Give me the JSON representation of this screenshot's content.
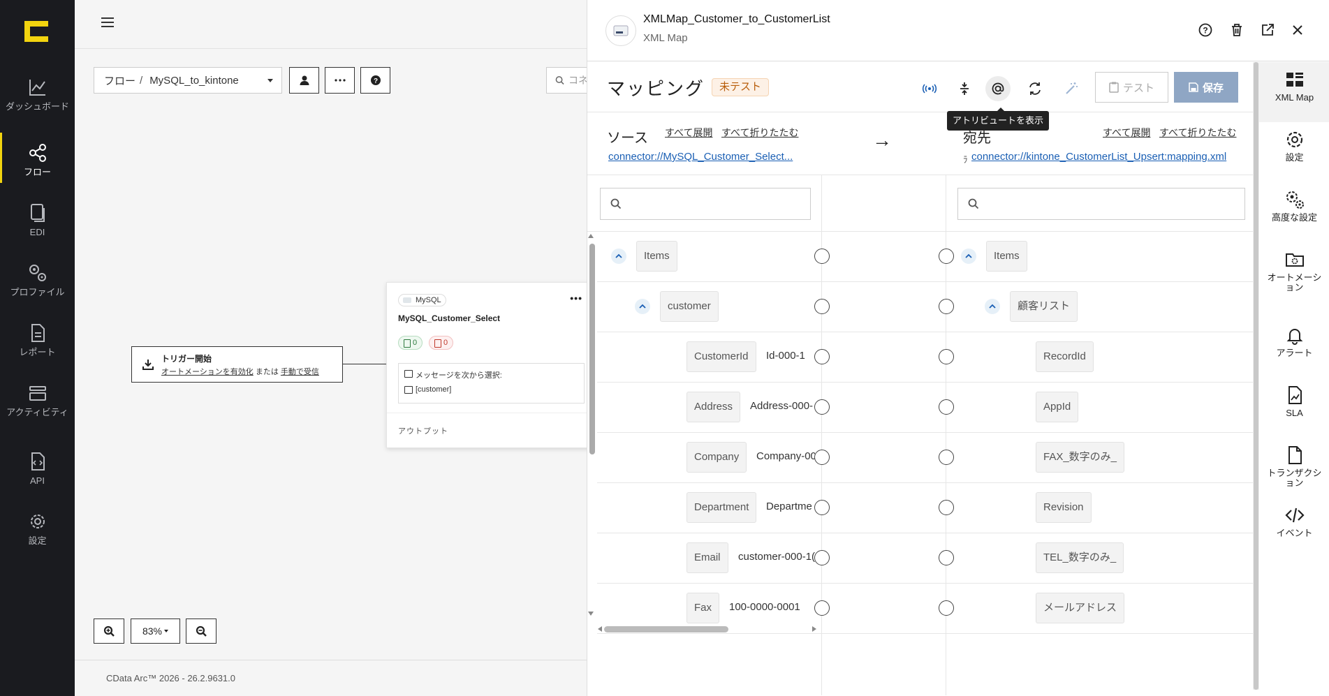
{
  "sidebar": {
    "items": [
      {
        "label": "ダッシュボード",
        "icon": "chart-line-icon"
      },
      {
        "label": "フロー",
        "icon": "flow-icon",
        "active": true
      },
      {
        "label": "EDI",
        "icon": "documents-icon"
      },
      {
        "label": "プロファイル",
        "icon": "gears-icon"
      },
      {
        "label": "レポート",
        "icon": "report-icon"
      },
      {
        "label": "アクティビティ",
        "icon": "activity-icon"
      },
      {
        "label": "API",
        "icon": "api-icon"
      },
      {
        "label": "設定",
        "icon": "gear-icon"
      }
    ]
  },
  "canvas": {
    "breadcrumb_prefix": "フロー",
    "breadcrumb_sep": "/",
    "flow_name": "MySQL_to_kintone",
    "search_placeholder": "コネ",
    "trigger": {
      "title": "トリガー開始",
      "link1": "オートメーションを有効化",
      "or_text": "または",
      "link2": "手動で受信"
    },
    "node": {
      "tag": "MySQL",
      "name": "MySQL_Customer_Select",
      "ok_count": "0",
      "err_count": "0",
      "msg_label": "メッセージを次から選択:",
      "msg_value": "[customer]",
      "output_label": "アウトプット"
    },
    "zoom_level": "83%",
    "footer": "CData Arc™ 2026 - 26.2.9631.0"
  },
  "panel": {
    "title": "XMLMap_Customer_to_CustomerList",
    "subtitle": "XML Map",
    "mapping_title": "マッピング",
    "status_badge": "未テスト",
    "tooltip": "アトリビュートを表示",
    "test_label": "テスト",
    "save_label": "保存",
    "source": {
      "label": "ソース",
      "expand_all": "すべて展開",
      "collapse_all": "すべて折りたたむ",
      "uri": "connector://MySQL_Customer_Select..."
    },
    "dest": {
      "label": "宛先",
      "expand_all": "すべて展開",
      "collapse_all": "すべて折りたたむ",
      "uri_prefix": "ﾗ",
      "uri": "connector://kintone_CustomerList_Upsert:mapping.xml"
    },
    "source_rows": [
      {
        "name": "Items",
        "value": ""
      },
      {
        "name": "customer",
        "value": ""
      },
      {
        "name": "CustomerId",
        "value": "Id-000-1"
      },
      {
        "name": "Address",
        "value": "Address-000-"
      },
      {
        "name": "Company",
        "value": "Company-00"
      },
      {
        "name": "Department",
        "value": "Departme"
      },
      {
        "name": "Email",
        "value": "customer-000-1("
      },
      {
        "name": "Fax",
        "value": "100-0000-0001"
      }
    ],
    "dest_rows": [
      {
        "name": "Items"
      },
      {
        "name": "顧客リスト"
      },
      {
        "name": "RecordId"
      },
      {
        "name": "AppId"
      },
      {
        "name": "FAX_数字のみ_"
      },
      {
        "name": "Revision"
      },
      {
        "name": "TEL_数字のみ_"
      },
      {
        "name": "メールアドレス"
      }
    ],
    "right_bar": [
      {
        "label": "XML Map",
        "icon": "xml-map-icon",
        "active": true
      },
      {
        "label": "設定",
        "icon": "gear-icon"
      },
      {
        "label": "高度な設定",
        "icon": "gears-icon"
      },
      {
        "label": "オートメーション",
        "icon": "folder-gear-icon"
      },
      {
        "label": "アラート",
        "icon": "bell-icon"
      },
      {
        "label": "SLA",
        "icon": "sla-icon"
      },
      {
        "label": "トランザクション",
        "icon": "file-icon"
      },
      {
        "label": "イベント",
        "icon": "code-icon"
      }
    ]
  }
}
